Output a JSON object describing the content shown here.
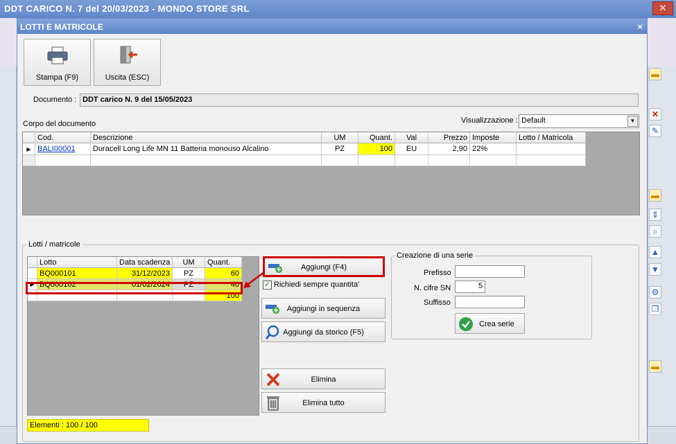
{
  "window": {
    "title": "DDT CARICO N. 7 del 20/03/2023 - MONDO STORE SRL",
    "close_glyph": "✕"
  },
  "dialog": {
    "title": "LOTTI E MATRICOLE",
    "close_glyph": "×"
  },
  "toolbar": {
    "print_label": "Stampa (F9)",
    "exit_label": "Uscita (ESC)"
  },
  "document": {
    "label": "Documento :",
    "value": "DDT carico N. 9 del 15/05/2023"
  },
  "body_section": {
    "label": "Corpo del documento",
    "view_label": "Visualizzazione :",
    "view_value": "Default"
  },
  "body_table": {
    "columns": [
      "Cod.",
      "Descrizione",
      "UM",
      "Quant.",
      "Val",
      "Prezzo",
      "Imposte",
      "Lotto / Matricola"
    ],
    "rows": [
      {
        "cod": "BALI00001",
        "descrizione": "Duracell Long Life MN 11 Batteria monouso Alcalino",
        "um": "PZ",
        "quant": "100",
        "val": "EU",
        "prezzo": "2,90",
        "imposte": "22%",
        "lotto": ""
      }
    ]
  },
  "lots_section": {
    "label": "Lotti / matricole"
  },
  "lots_table": {
    "columns": [
      "Lotto",
      "Data scadenza",
      "UM",
      "Quant."
    ],
    "rows": [
      {
        "lotto": "BQ000101",
        "scadenza": "31/12/2023",
        "um": "PZ",
        "quant": "60"
      },
      {
        "lotto": "BQ000102",
        "scadenza": "01/02/2024",
        "um": "PZ",
        "quant": "40"
      }
    ],
    "total": "100"
  },
  "elements_count": "Elementi : 100 / 100",
  "actions": {
    "add": "Aggiungi (F4)",
    "always_ask_qty": "Richiedi sempre quantita'",
    "add_sequence": "Aggiungi in sequenza",
    "add_history": "Aggiungi da storico (F5)",
    "delete": "Elimina",
    "delete_all": "Elimina tutto"
  },
  "series": {
    "title": "Creazione di una serie",
    "prefix_label": "Prefisso",
    "prefix_value": "",
    "digits_label": "N. cifre SN",
    "digits_value": "5",
    "suffix_label": "Suffisso",
    "suffix_value": "",
    "create_label": "Crea serie"
  },
  "colors": {
    "highlight": "#ffff00",
    "callout": "#cc0000",
    "title_bar": "#6a8fce"
  }
}
